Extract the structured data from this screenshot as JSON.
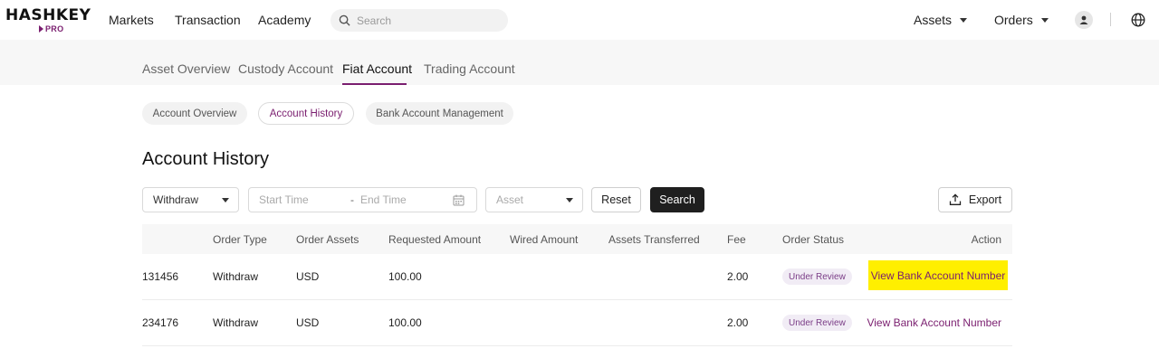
{
  "brand": {
    "name": "HASHKEY",
    "sub": "PRO"
  },
  "nav": {
    "links": [
      "Markets",
      "Transaction",
      "Academy"
    ],
    "search_placeholder": "Search",
    "assets_label": "Assets",
    "orders_label": "Orders"
  },
  "tabs": [
    "Asset Overview",
    "Custody Account",
    "Fiat Account",
    "Trading Account"
  ],
  "active_tab": "Fiat Account",
  "subtabs": [
    "Account Overview",
    "Account History",
    "Bank Account Management"
  ],
  "active_subtab": "Account History",
  "page_title": "Account History",
  "filters": {
    "type_value": "Withdraw",
    "start_placeholder": "Start Time",
    "range_separator": "-",
    "end_placeholder": "End Time",
    "asset_placeholder": "Asset",
    "reset_label": "Reset",
    "search_label": "Search",
    "export_label": "Export"
  },
  "table": {
    "headers": [
      "",
      "Order Type",
      "Order Assets",
      "Requested Amount",
      "Wired Amount",
      "Assets Transferred",
      "Fee",
      "Order Status",
      "Action"
    ],
    "rows": [
      {
        "id": "131456",
        "type": "Withdraw",
        "asset": "USD",
        "requested": "100.00",
        "wired": "",
        "transferred": "",
        "fee": "2.00",
        "status": "Under Review",
        "action": "View Bank Account Number",
        "highlighted": true
      },
      {
        "id": "234176",
        "type": "Withdraw",
        "asset": "USD",
        "requested": "100.00",
        "wired": "",
        "transferred": "",
        "fee": "2.00",
        "status": "Under Review",
        "action": "View Bank Account Number",
        "highlighted": false
      }
    ]
  },
  "colors": {
    "accent": "#7a1e6f",
    "highlight": "#ffef00",
    "badge_bg": "#f1ecf5"
  },
  "icons": {
    "search": "search-icon",
    "export": "upload-icon",
    "calendar": "calendar-icon",
    "globe": "globe-icon",
    "user": "user-icon"
  }
}
